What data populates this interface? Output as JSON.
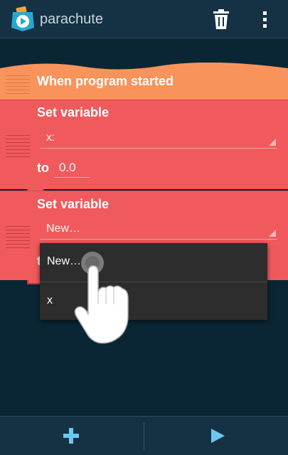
{
  "appbar": {
    "title": "parachute",
    "icons": {
      "app": "parachute-app-icon",
      "delete": "trash-icon",
      "menu": "overflow-menu-icon"
    }
  },
  "script": {
    "start_block": {
      "label": "When program started"
    },
    "blocks": [
      {
        "label": "Set variable",
        "variable": "x:",
        "to_label": "to",
        "to_value": "0.0"
      },
      {
        "label": "Set variable",
        "variable": "New…",
        "to_label": "t"
      }
    ]
  },
  "dropdown": {
    "items": [
      "New…",
      "x"
    ]
  },
  "bottombar": {
    "icons": {
      "add": "plus-icon",
      "run": "play-icon"
    }
  },
  "colors": {
    "start_block": "#f8945b",
    "set_block": "#f05a5c",
    "appbar": "#143244",
    "background": "#0a2634",
    "menu": "#2d2d2d",
    "accent": "#6ec7f0"
  }
}
